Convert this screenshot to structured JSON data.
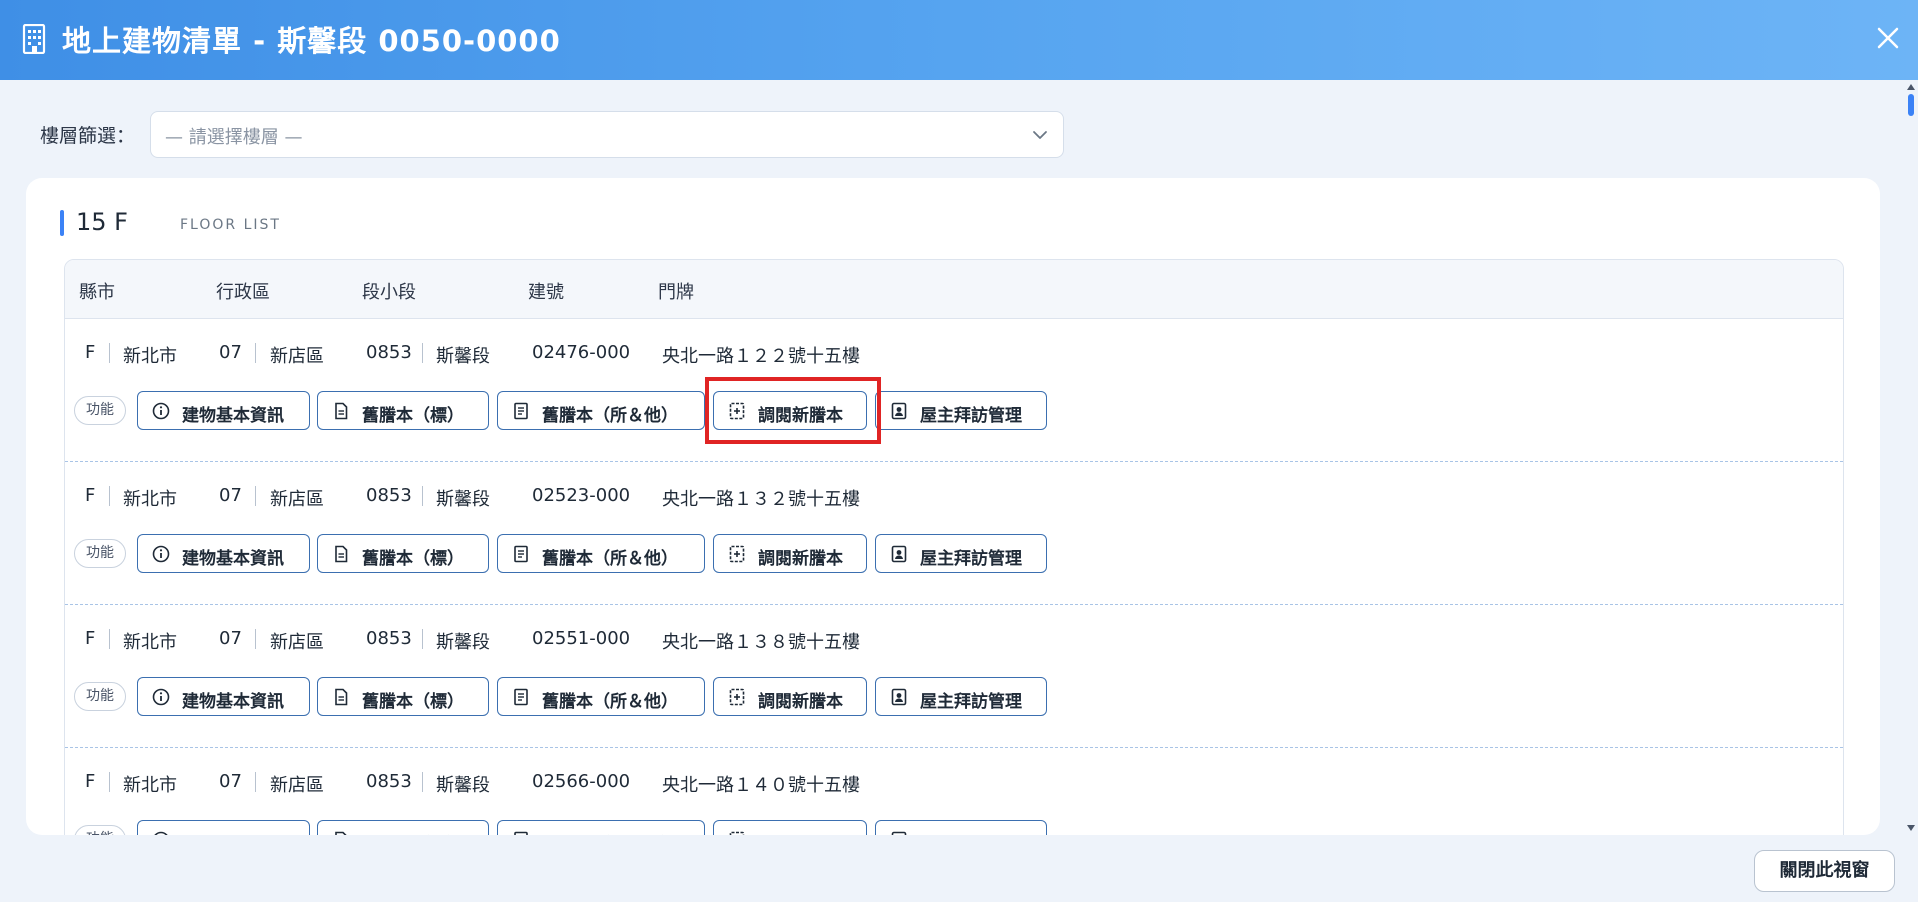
{
  "window": {
    "title": "地上建物清單 - 斯馨段 0050-0000"
  },
  "filter": {
    "label": "樓層篩選：",
    "placeholder": "— 請選擇樓層 —"
  },
  "floor": {
    "title": "15 F",
    "subtitle": "FLOOR LIST"
  },
  "table": {
    "headers": [
      "縣市",
      "行政區",
      "段小段",
      "建號",
      "門牌"
    ],
    "rows": [
      {
        "county_code": "F",
        "county": "新北市",
        "district_code": "07",
        "district": "新店區",
        "section_code": "0853",
        "section": "斯馨段",
        "building_no": "02476-000",
        "address": "央北一路１２２號十五樓"
      },
      {
        "county_code": "F",
        "county": "新北市",
        "district_code": "07",
        "district": "新店區",
        "section_code": "0853",
        "section": "斯馨段",
        "building_no": "02523-000",
        "address": "央北一路１３２號十五樓"
      },
      {
        "county_code": "F",
        "county": "新北市",
        "district_code": "07",
        "district": "新店區",
        "section_code": "0853",
        "section": "斯馨段",
        "building_no": "02551-000",
        "address": "央北一路１３８號十五樓"
      },
      {
        "county_code": "F",
        "county": "新北市",
        "district_code": "07",
        "district": "新店區",
        "section_code": "0853",
        "section": "斯馨段",
        "building_no": "02566-000",
        "address": "央北一路１４０號十五樓"
      }
    ]
  },
  "actions": {
    "func_label": "功能",
    "basic_info": "建物基本資訊",
    "old_transcript_label": "舊謄本（標）",
    "old_transcript_owner": "舊謄本（所＆他）",
    "new_transcript": "調閱新謄本",
    "owner_visit": "屋主拜訪管理"
  },
  "footer": {
    "close_label": "關閉此視窗"
  },
  "colors": {
    "header_start": "#3f8fe6",
    "header_end": "#6db4f6",
    "accent": "#3b82f6",
    "button_border": "#3b6fb0",
    "highlight": "#e02424"
  }
}
